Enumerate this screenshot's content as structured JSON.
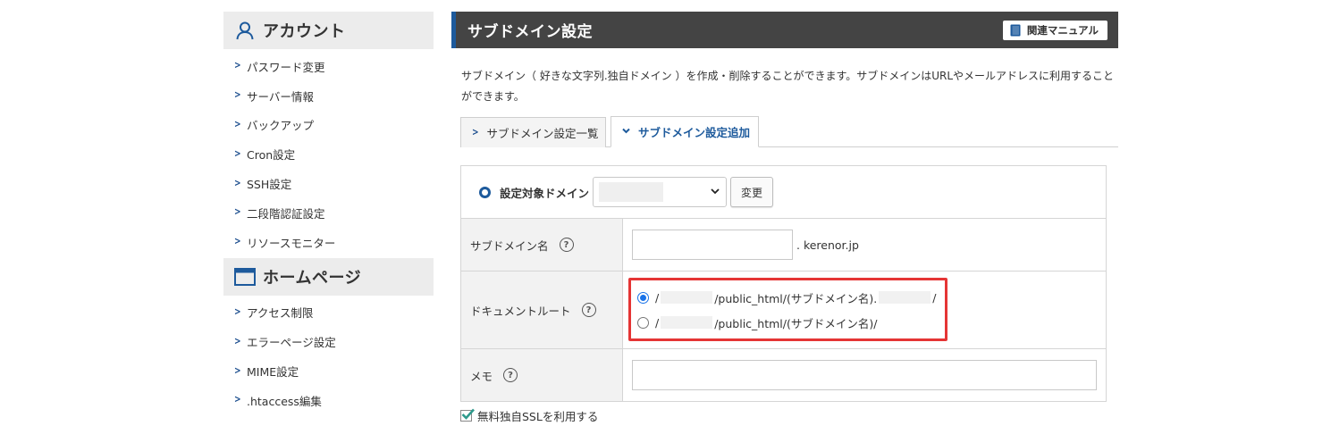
{
  "sidebar": {
    "account": {
      "title": "アカウント",
      "items": [
        "パスワード変更",
        "サーバー情報",
        "バックアップ",
        "Cron設定",
        "SSH設定",
        "二段階認証設定",
        "リソースモニター"
      ]
    },
    "homepage": {
      "title": "ホームページ",
      "items": [
        "アクセス制限",
        "エラーページ設定",
        "MIME設定",
        ".htaccess編集"
      ]
    }
  },
  "header": {
    "title": "サブドメイン設定",
    "manual_label": "関連マニュアル"
  },
  "description": "サブドメイン（ 好きな文字列.独自ドメイン ）を作成・削除することができます。サブドメインはURLやメールアドレスに利用することができます。",
  "tabs": [
    {
      "label": "サブドメイン設定一覧",
      "active": false
    },
    {
      "label": "サブドメイン設定追加",
      "active": true
    }
  ],
  "form": {
    "target_domain_label": "設定対象ドメイン",
    "change_button": "変更",
    "subdomain_label": "サブドメイン名",
    "subdomain_value": "",
    "subdomain_suffix": ". kerenor.jp",
    "docroot_label": "ドキュメントルート",
    "docroot_options": [
      {
        "prefix": "/",
        "path": "/public_html/(サブドメイン名).",
        "suffix": "/",
        "selected": true
      },
      {
        "prefix": "/",
        "path": "/public_html/(サブドメイン名)/",
        "suffix": "",
        "selected": false
      }
    ],
    "memo_label": "メモ",
    "memo_value": "",
    "help_mark": "?",
    "ssl_label": "無料独自SSLを利用する",
    "ssl_checked": true
  },
  "colors": {
    "accent": "#1d5a9c",
    "header_bg": "#444444",
    "highlight": "#e53535",
    "checkbox": "#2e9a8c"
  }
}
